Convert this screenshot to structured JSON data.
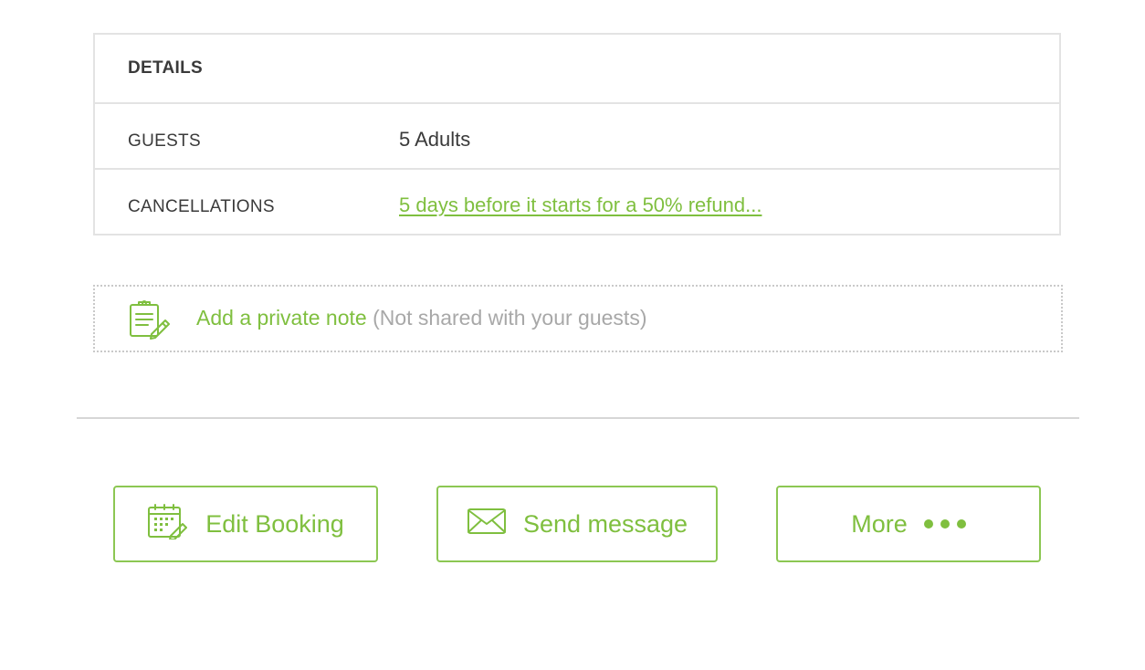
{
  "details": {
    "header": "DETAILS",
    "rows": [
      {
        "label": "GUESTS",
        "value": "5 Adults"
      },
      {
        "label": "CANCELLATIONS",
        "value": "5 days before it starts for a 50% refund..."
      }
    ]
  },
  "private_note": {
    "action": "Add a private note",
    "hint": "(Not shared with your guests)",
    "icon": "clipboard-pencil-icon"
  },
  "actions": {
    "edit_booking": {
      "label": "Edit Booking",
      "icon": "calendar-pencil-icon"
    },
    "send_message": {
      "label": "Send message",
      "icon": "envelope-icon"
    },
    "more": {
      "label": "More",
      "icon": "ellipsis-icon"
    }
  },
  "colors": {
    "accent": "#7fbf3f",
    "border": "#e3e3e3",
    "muted_text": "#a8a8a8",
    "text": "#3a3a3a"
  }
}
